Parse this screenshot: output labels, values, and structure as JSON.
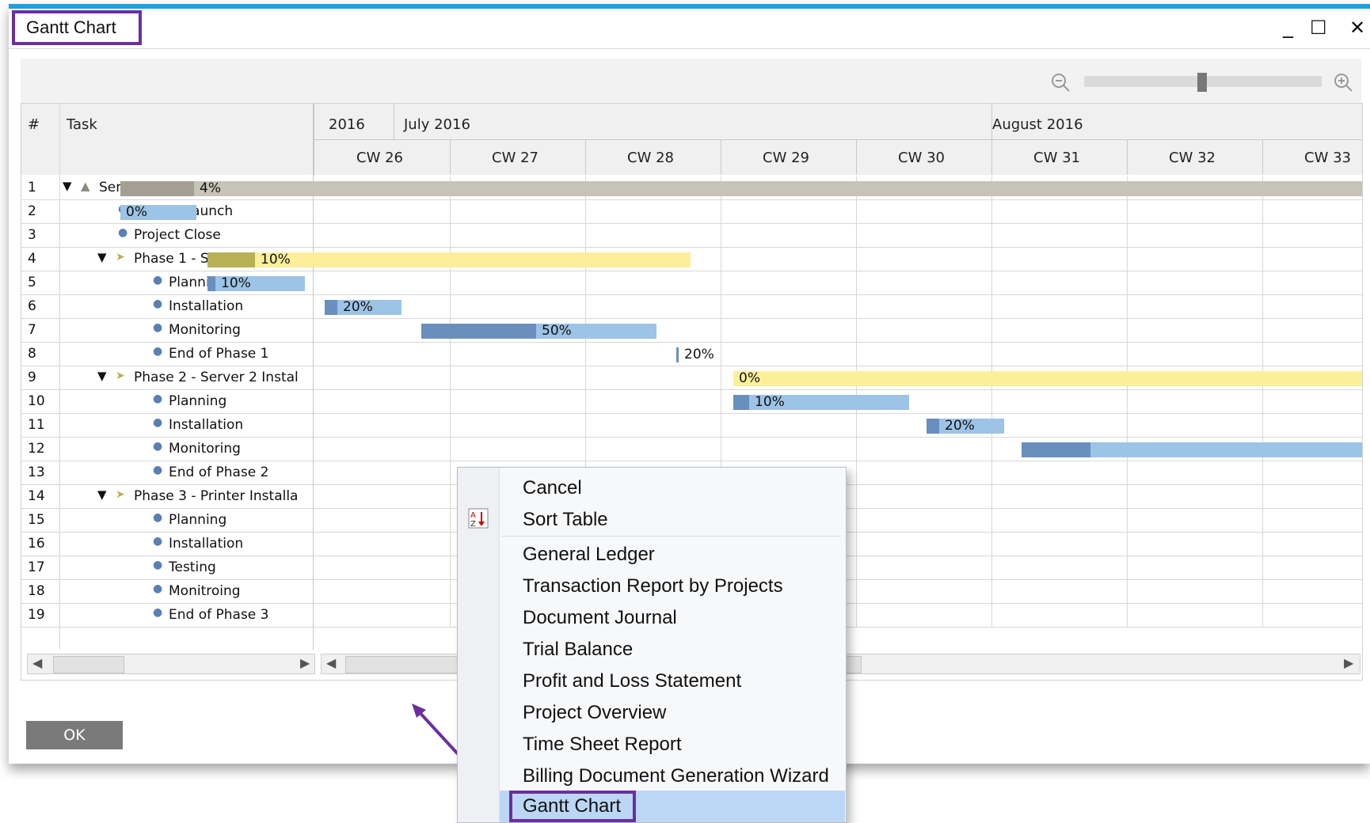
{
  "window": {
    "title": "Gantt Chart",
    "minimize_glyph": "_",
    "maximize_glyph": "☐",
    "close_glyph": "✕",
    "icons": {
      "zoom_out": "zoom-out-icon",
      "zoom_in": "zoom-in-icon"
    }
  },
  "zoom": {
    "level": 0.48
  },
  "table": {
    "col_num": "#",
    "col_task": "Task",
    "years": [
      "2016",
      "July 2016",
      "August 2016"
    ],
    "weeks": [
      "CW 26",
      "CW 27",
      "CW 28",
      "CW 29",
      "CW 30",
      "CW 31",
      "CW 32",
      "CW 33"
    ],
    "rows": [
      {
        "num": "1",
        "name": "Servers & Printer Installation",
        "level": 0,
        "kind": "project",
        "pct": "4%"
      },
      {
        "num": "2",
        "name": "Project Launch",
        "level": 1,
        "kind": "task",
        "pct": "0%"
      },
      {
        "num": "3",
        "name": "Project Close",
        "level": 1,
        "kind": "task",
        "pct": ""
      },
      {
        "num": "4",
        "name": "Phase 1 - Server 1 Instal",
        "level": 1,
        "kind": "phase",
        "pct": "10%"
      },
      {
        "num": "5",
        "name": "Planning",
        "level": 2,
        "kind": "task",
        "pct": "10%"
      },
      {
        "num": "6",
        "name": "Installation",
        "level": 2,
        "kind": "task",
        "pct": "20%"
      },
      {
        "num": "7",
        "name": "Monitoring",
        "level": 2,
        "kind": "task",
        "pct": "50%"
      },
      {
        "num": "8",
        "name": "End of Phase 1",
        "level": 2,
        "kind": "task",
        "pct": "20%"
      },
      {
        "num": "9",
        "name": "Phase 2 - Server 2 Instal",
        "level": 1,
        "kind": "phase",
        "pct": "0%"
      },
      {
        "num": "10",
        "name": "Planning",
        "level": 2,
        "kind": "task",
        "pct": "10%"
      },
      {
        "num": "11",
        "name": "Installation",
        "level": 2,
        "kind": "task",
        "pct": "20%"
      },
      {
        "num": "12",
        "name": "Monitoring",
        "level": 2,
        "kind": "task",
        "pct": ""
      },
      {
        "num": "13",
        "name": "End of Phase 2",
        "level": 2,
        "kind": "task",
        "pct": ""
      },
      {
        "num": "14",
        "name": "Phase 3 - Printer Installa",
        "level": 1,
        "kind": "phase",
        "pct": ""
      },
      {
        "num": "15",
        "name": "Planning",
        "level": 2,
        "kind": "task",
        "pct": ""
      },
      {
        "num": "16",
        "name": "Installation",
        "level": 2,
        "kind": "task",
        "pct": ""
      },
      {
        "num": "17",
        "name": "Testing",
        "level": 2,
        "kind": "task",
        "pct": ""
      },
      {
        "num": "18",
        "name": "Monitroing",
        "level": 2,
        "kind": "task",
        "pct": ""
      },
      {
        "num": "19",
        "name": "End of Phase 3",
        "level": 2,
        "kind": "task",
        "pct": ""
      }
    ]
  },
  "colors": {
    "project_bar": "#c6c4b6",
    "project_done": "#a39f92",
    "phase_bar": "#fbef9a",
    "phase_done": "#b9af55",
    "task_bar": "#9dc3e6",
    "task_done": "#6a8fbf",
    "accent": "#6b2fa0"
  },
  "ok_button": "OK",
  "context_menu": {
    "items": [
      "Cancel",
      "Sort Table",
      "General Ledger",
      "Transaction Report by Projects",
      "Document Journal",
      "Trial Balance",
      "Profit and Loss Statement",
      "Project Overview",
      "Time Sheet Report",
      "Billing Document Generation Wizard",
      "Gantt Chart"
    ],
    "selected": "Gantt Chart",
    "sort_icon": "sort-az-icon"
  }
}
